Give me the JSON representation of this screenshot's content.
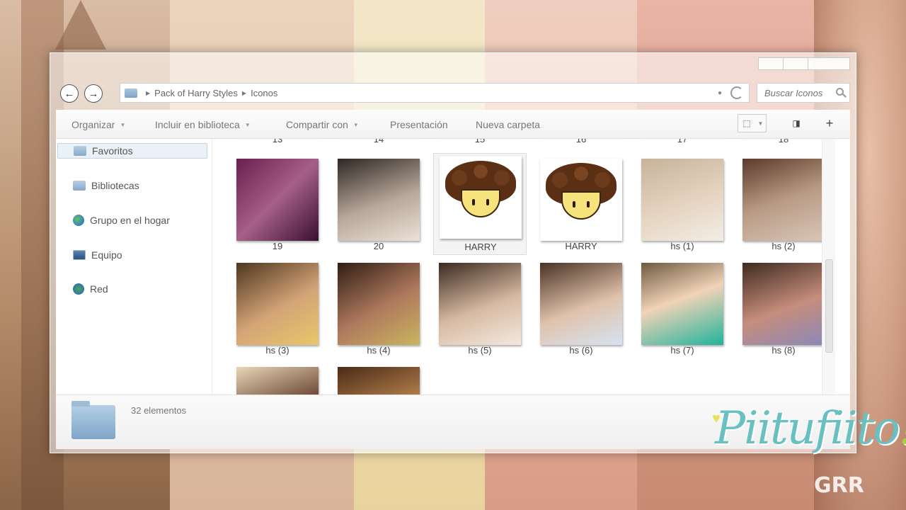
{
  "window": {
    "breadcrumb": [
      "Pack of Harry Styles",
      "Iconos"
    ],
    "search_placeholder": "Buscar Iconos"
  },
  "toolbar": {
    "organize": "Organizar",
    "include_library": "Incluir en biblioteca",
    "share_with": "Compartir con",
    "slideshow": "Presentación",
    "new_folder": "Nueva carpeta"
  },
  "sidebar": {
    "items": [
      {
        "label": "Favoritos",
        "icon": "star-folder-icon"
      },
      {
        "label": "Bibliotecas",
        "icon": "library-icon"
      },
      {
        "label": "Grupo en el hogar",
        "icon": "homegroup-icon"
      },
      {
        "label": "Equipo",
        "icon": "computer-icon"
      },
      {
        "label": "Red",
        "icon": "network-icon"
      }
    ]
  },
  "files": {
    "row0": [
      "13",
      "14",
      "15",
      "16",
      "17",
      "18"
    ],
    "row1": [
      "19",
      "20",
      "HARRY",
      "HARRY",
      "hs (1)",
      "hs (2)"
    ],
    "row2": [
      "hs (3)",
      "hs (4)",
      "hs (5)",
      "hs (6)",
      "hs (7)",
      "hs (8)"
    ]
  },
  "details": {
    "count": "32 elementos"
  },
  "watermark": {
    "logo": "Piitufiito",
    "bang": "!",
    "sub": "GRR"
  }
}
